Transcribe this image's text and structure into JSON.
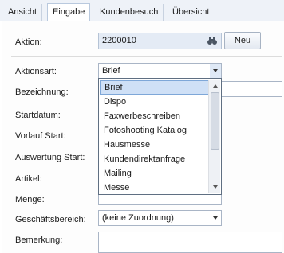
{
  "tabs": [
    {
      "label": "Ansicht",
      "active": false
    },
    {
      "label": "Eingabe",
      "active": true
    },
    {
      "label": "Kundenbesuch",
      "active": false
    },
    {
      "label": "Übersicht",
      "active": false
    }
  ],
  "form": {
    "aktion_label": "Aktion:",
    "aktion_value": "2200010",
    "neu_button": "Neu",
    "aktionsart_label": "Aktionsart:",
    "aktionsart_value": "Brief",
    "bezeichnung_label": "Bezeichnung:",
    "startdatum_label": "Startdatum:",
    "vorlauf_start_label": "Vorlauf Start:",
    "auswertung_start_label": "Auswertung Start:",
    "artikel_label": "Artikel:",
    "menge_label": "Menge:",
    "geschaeftsbereich_label": "Geschäftsbereich:",
    "geschaeftsbereich_value": "(keine Zuordnung)",
    "bemerkung_label": "Bemerkung:"
  },
  "dropdown": {
    "items": [
      "Brief",
      "Dispo",
      "Faxwerbeschreiben",
      "Fotoshooting Katalog",
      "Hausmesse",
      "Kundendirektanfrage",
      "Mailing",
      "Messe"
    ],
    "selected": "Brief"
  },
  "icons": {
    "binoculars": "binoculars-icon"
  }
}
